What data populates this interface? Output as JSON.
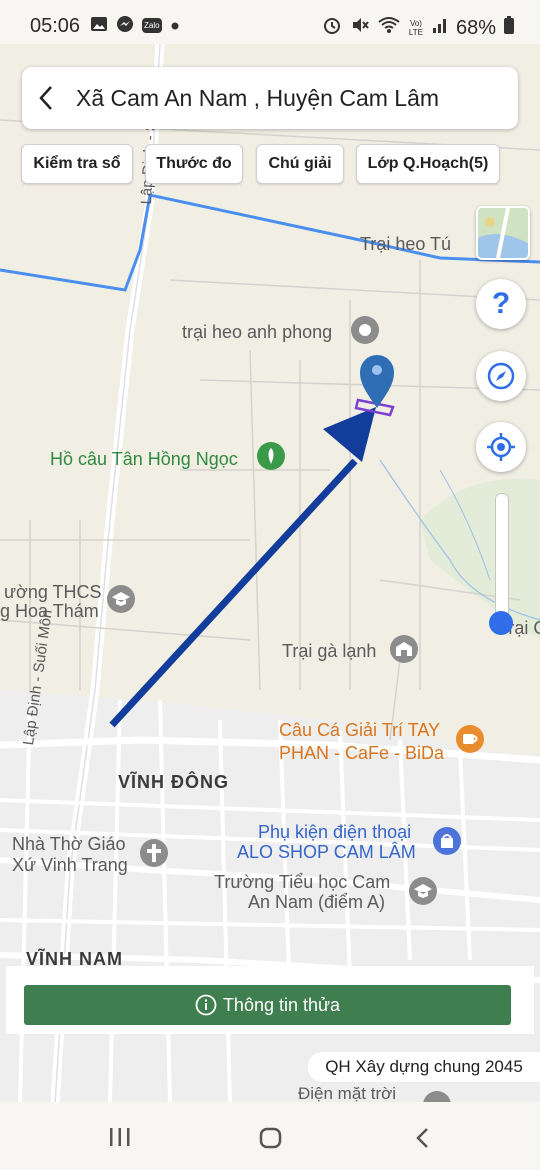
{
  "status_bar": {
    "time": "05:06",
    "left_icons": [
      "gallery-icon",
      "messenger-icon",
      "zalo-icon",
      "dot-icon"
    ],
    "zalo_label": "Zalo",
    "battery": "68%",
    "right_icons": [
      "alarm-icon",
      "mute-icon",
      "wifi-icon",
      "volte-icon",
      "signal-icon",
      "battery-icon"
    ],
    "volte_label": "Vo) LTE"
  },
  "header": {
    "title": "Xã Cam An Nam , Huyện Cam Lâm"
  },
  "chips": [
    {
      "label": "Kiểm tra sổ"
    },
    {
      "label": "Thước đo"
    },
    {
      "label": "Chú giải"
    },
    {
      "label": "Lớp Q.Hoạch(5)"
    }
  ],
  "map": {
    "labels": {
      "trai_heo_tu": "Trại heo Tú",
      "trai_heo_anh_phong": "trại heo anh phong",
      "ho_cau": "Hồ câu Tân Hồng Ngọc",
      "truong_thcs_1": "ường THCS",
      "truong_thcs_2": "g Hoa Thám",
      "trai_ga_lanh": "Trại gà lạnh",
      "trai_ga_edge": "Trại Ga",
      "cau_ca_1": "Câu Cá Giải Trí TAY",
      "cau_ca_2": "PHAN - CaFe - BiDa",
      "vinh_dong": "VĨNH ĐÔNG",
      "phu_kien_1": "Phụ kiện điện thoại",
      "phu_kien_2": "ALO SHOP CAM LÂM",
      "nha_tho_1": "Nhà Thờ Giáo",
      "nha_tho_2": "Xứ Vinh Trang",
      "truong_tieu_hoc_1": "Trường Tiểu học Cam",
      "truong_tieu_hoc_2": "An Nam (điểm A)",
      "vinh_nam": "VĨNH NAM",
      "road_lap_dinh": "Lập Định - Suối Môn",
      "road_top": "Lập Định - Suối Môn",
      "dien_mat_troi": "Điện mặt trời"
    }
  },
  "controls": {
    "help_symbol": "?",
    "zoom_level": 0.05
  },
  "bottom": {
    "info_button": "Thông tin thửa",
    "plan_label": "QH Xây dựng chung 2045"
  },
  "colors": {
    "accent_green": "#3f7f4f",
    "marker_blue": "#2f6db5",
    "arrow_blue": "#123d9a",
    "parcel_purple": "#7b3fd1",
    "boundary_blue": "#4a8ef0"
  }
}
